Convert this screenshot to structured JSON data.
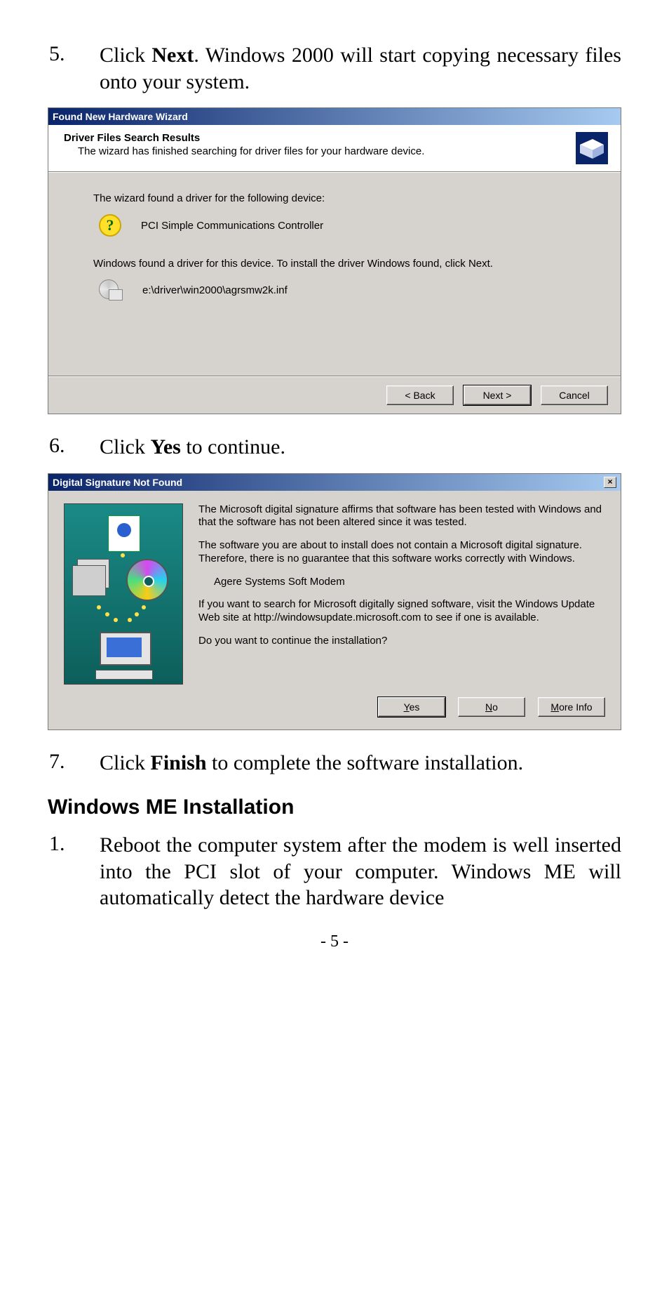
{
  "steps_a": [
    {
      "num": "5.",
      "parts": [
        "Click ",
        {
          "b": "Next"
        },
        ".   Windows 2000 will start copying necessary files onto your system."
      ]
    },
    {
      "num": "6.",
      "parts": [
        "Click ",
        {
          "b": "Yes"
        },
        " to continue."
      ]
    },
    {
      "num": "7.",
      "parts": [
        "Click ",
        {
          "b": "Finish"
        },
        " to complete the software installation."
      ]
    }
  ],
  "section_heading": "Windows ME Installation",
  "steps_b": [
    {
      "num": "1.",
      "parts": [
        "Reboot the computer system after the modem is well inserted into the PCI slot of your computer. Windows ME will automatically detect the hardware device"
      ]
    }
  ],
  "page_number": "- 5 -",
  "dialog1": {
    "title": "Found New Hardware Wizard",
    "header_title": "Driver Files Search Results",
    "header_sub": "The wizard has finished searching for driver files for your hardware device.",
    "line1": "The wizard found a driver for the following device:",
    "device_name": "PCI Simple Communications Controller",
    "line2": "Windows found a driver for this device. To install the driver Windows found, click Next.",
    "inf_path": "e:\\driver\\win2000\\agrsmw2k.inf",
    "buttons": {
      "back": "< Back",
      "next": "Next >",
      "cancel": "Cancel"
    }
  },
  "dialog2": {
    "title": "Digital Signature Not Found",
    "p1": "The Microsoft digital signature affirms that software has been tested with Windows and that the software has not been altered since it was tested.",
    "p2": "The software you are about to install does not contain a Microsoft digital signature. Therefore,  there is no guarantee that this software works correctly with Windows.",
    "device_name": "Agere Systems Soft Modem",
    "p3": "If you want to search for Microsoft digitally signed software, visit the Windows Update Web site at http://windowsupdate.microsoft.com to see if one is available.",
    "p4": "Do you want to continue the installation?",
    "buttons": {
      "yes": "Yes",
      "no": "No",
      "more": "More Info"
    }
  }
}
